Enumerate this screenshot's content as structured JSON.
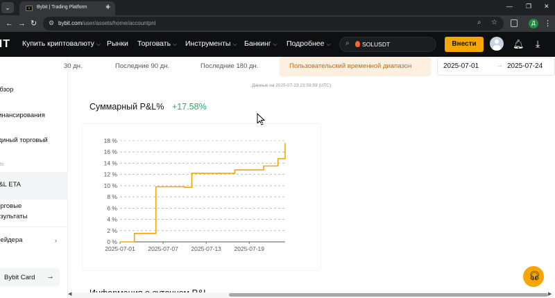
{
  "browser": {
    "tab_title": "Bybit | Trading Platform",
    "url_host": "bybit.com",
    "url_path": "/user/assets/home/accountpnl",
    "profile_initial": "Д"
  },
  "header": {
    "logo_text": "BYBIT",
    "nav": [
      {
        "label": "Купить криптовалюту",
        "has_dropdown": true
      },
      {
        "label": "Рынки",
        "has_dropdown": false
      },
      {
        "label": "Торговать",
        "has_dropdown": true
      },
      {
        "label": "Инструменты",
        "has_dropdown": true
      },
      {
        "label": "Банкинг",
        "has_dropdown": true
      },
      {
        "label": "Подробнее",
        "has_dropdown": true
      }
    ],
    "search_value": "SOLUSDT",
    "deposit_label": "Внести"
  },
  "sidebar": {
    "items": [
      {
        "label": "Обзор"
      },
      {
        "label": "Финансирования"
      },
      {
        "label": "Единый торговый"
      },
      {
        "label": "P&L ETA"
      },
      {
        "label": "Торговые"
      },
      {
        "label": "результаты"
      },
      {
        "label": "Трейдера"
      }
    ],
    "section_label": "ts",
    "card_label": "Bybit Card"
  },
  "range": {
    "tabs": [
      "30 дн.",
      "Последние 90 дн.",
      "Последние 180 дн."
    ],
    "active_tab": "Пользовательский временной диапазон",
    "date_from": "2025-07-01",
    "date_to": "2025-07-24"
  },
  "as_of": "Данные на 2025-07-23 23:59:59 (UTC)",
  "pnl": {
    "title": "Суммарный P&L%",
    "value": "+17.58%"
  },
  "chart_data": {
    "type": "line",
    "color": "#f7a600",
    "x": [
      "2025-07-01",
      "2025-07-02",
      "2025-07-03",
      "2025-07-04",
      "2025-07-05",
      "2025-07-06",
      "2025-07-07",
      "2025-07-08",
      "2025-07-09",
      "2025-07-10",
      "2025-07-11",
      "2025-07-12",
      "2025-07-13",
      "2025-07-14",
      "2025-07-15",
      "2025-07-16",
      "2025-07-17",
      "2025-07-18",
      "2025-07-19",
      "2025-07-20",
      "2025-07-21",
      "2025-07-22",
      "2025-07-23"
    ],
    "y": [
      0,
      0,
      1.5,
      1.5,
      1.5,
      9.8,
      9.8,
      9.8,
      9.8,
      9.7,
      12.2,
      12.2,
      12.2,
      12.2,
      12.2,
      12.2,
      12.8,
      12.8,
      12.8,
      12.8,
      13.5,
      13.5,
      14.8,
      17.58
    ],
    "x_ticks": [
      "2025-07-01",
      "2025-07-07",
      "2025-07-13",
      "2025-07-19"
    ],
    "y_ticks": [
      "0 %",
      "2 %",
      "4 %",
      "6 %",
      "8 %",
      "10 %",
      "12 %",
      "14 %",
      "16 %",
      "18 %"
    ],
    "ylim": [
      0,
      18
    ],
    "grid": true
  },
  "next_section_title": "Информация о суточном P&L"
}
